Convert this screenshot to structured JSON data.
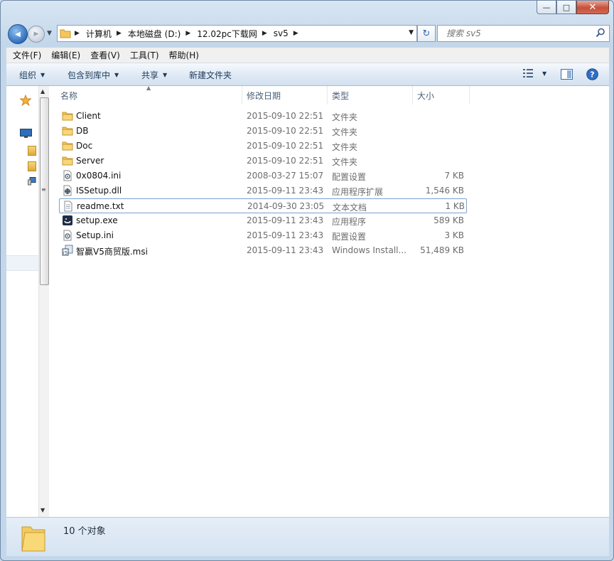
{
  "window": {
    "minimize_label": "—",
    "maximize_label": "□",
    "close_label": "✕"
  },
  "nav": {
    "back_glyph": "◀",
    "forward_glyph": "▶",
    "recent_glyph": "▼",
    "refresh_glyph": "↻",
    "dropdown_glyph": "▼"
  },
  "breadcrumb": [
    {
      "label": "计算机"
    },
    {
      "label": "本地磁盘 (D:)"
    },
    {
      "label": "12.02pc下载网"
    },
    {
      "label": "sv5"
    }
  ],
  "search": {
    "placeholder": "搜索 sv5"
  },
  "menu": [
    "文件(F)",
    "编辑(E)",
    "查看(V)",
    "工具(T)",
    "帮助(H)"
  ],
  "toolbar": {
    "organize": "组织",
    "include_library": "包含到库中",
    "share": "共享",
    "new_folder": "新建文件夹"
  },
  "columns": {
    "name": "名称",
    "date": "修改日期",
    "type": "类型",
    "size": "大小"
  },
  "files": [
    {
      "name": "Client",
      "date": "2015-09-10 22:51",
      "type": "文件夹",
      "size": "",
      "icon": "folder-icon"
    },
    {
      "name": "DB",
      "date": "2015-09-10 22:51",
      "type": "文件夹",
      "size": "",
      "icon": "folder-icon"
    },
    {
      "name": "Doc",
      "date": "2015-09-10 22:51",
      "type": "文件夹",
      "size": "",
      "icon": "folder-icon"
    },
    {
      "name": "Server",
      "date": "2015-09-10 22:51",
      "type": "文件夹",
      "size": "",
      "icon": "folder-icon"
    },
    {
      "name": "0x0804.ini",
      "date": "2008-03-27 15:07",
      "type": "配置设置",
      "size": "7 KB",
      "icon": "settings-file-icon"
    },
    {
      "name": "ISSetup.dll",
      "date": "2015-09-11 23:43",
      "type": "应用程序扩展",
      "size": "1,546 KB",
      "icon": "dll-file-icon"
    },
    {
      "name": "readme.txt",
      "date": "2014-09-30 23:05",
      "type": "文本文档",
      "size": "1 KB",
      "icon": "text-file-icon",
      "selected": true
    },
    {
      "name": "setup.exe",
      "date": "2015-09-11 23:43",
      "type": "应用程序",
      "size": "589 KB",
      "icon": "setup-exe-icon"
    },
    {
      "name": "Setup.ini",
      "date": "2015-09-11 23:43",
      "type": "配置设置",
      "size": "3 KB",
      "icon": "settings-file-icon"
    },
    {
      "name": "智赢V5商贸版.msi",
      "date": "2015-09-11 23:43",
      "type": "Windows Install...",
      "size": "51,489 KB",
      "icon": "installer-icon"
    }
  ],
  "status": {
    "count_text": "10 个对象"
  }
}
